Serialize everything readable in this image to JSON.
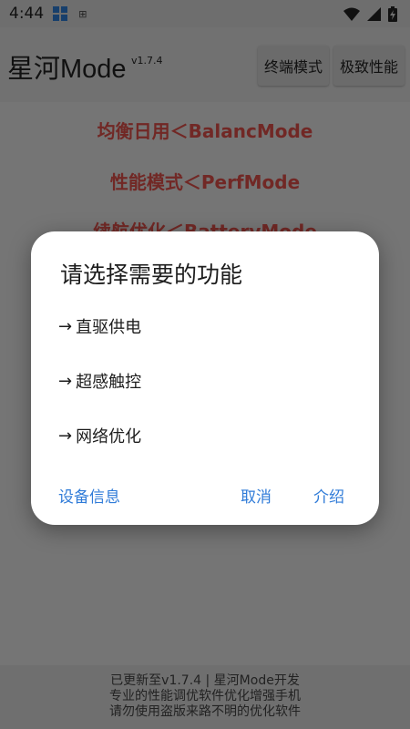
{
  "status_bar": {
    "time": "4:44",
    "icons": [
      "app-grid-icon",
      "grid-dots-icon",
      "wifi-icon",
      "signal-icon",
      "battery-charging-icon"
    ]
  },
  "header": {
    "title": "星河Mode",
    "version": "v1.7.4",
    "buttons": [
      "终端模式",
      "极致性能"
    ]
  },
  "modes": [
    "均衡日用＜BalancMode",
    "性能模式＜PerfMode",
    "续航优化＜BatteryMode"
  ],
  "footer": {
    "line1": "已更新至v1.7.4 | 星河Mode开发",
    "line2": "专业的性能调优软件优化增强手机",
    "line3": "请勿使用盗版来路不明的优化软件"
  },
  "dialog": {
    "title": "请选择需要的功能",
    "options": [
      {
        "arrow": "→",
        "label": "直驱供电"
      },
      {
        "arrow": "→",
        "label": "超感触控"
      },
      {
        "arrow": "→",
        "label": "网络优化"
      }
    ],
    "actions": {
      "device_info": "设备信息",
      "cancel": "取消",
      "intro": "介绍"
    }
  },
  "colors": {
    "accent": "#2f7bd8",
    "mode_text": "#e3504a",
    "scrim": "rgba(0,0,0,0.5)"
  }
}
